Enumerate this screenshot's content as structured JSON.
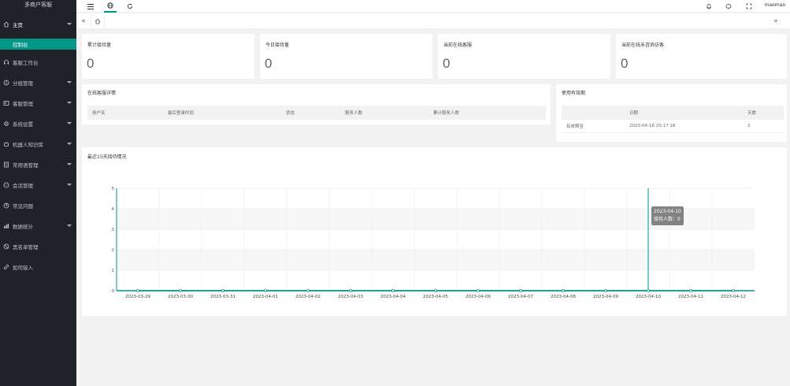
{
  "app": {
    "title": "多商户客服"
  },
  "sidebar": {
    "items": [
      {
        "label": "主页",
        "icon": "home-icon",
        "has_arrow": true,
        "active": true
      },
      {
        "label": "控制台",
        "sub": true,
        "selected": true
      },
      {
        "label": "客服工作台",
        "icon": "headset-icon",
        "has_arrow": false
      },
      {
        "label": "分组管理",
        "icon": "group-icon",
        "has_arrow": true
      },
      {
        "label": "客服管理",
        "icon": "user-card-icon",
        "has_arrow": true
      },
      {
        "label": "系统设置",
        "icon": "gear-icon",
        "has_arrow": true
      },
      {
        "label": "机器人知识库",
        "icon": "robot-icon",
        "has_arrow": true
      },
      {
        "label": "常用语管理",
        "icon": "note-icon",
        "has_arrow": true
      },
      {
        "label": "会话管理",
        "icon": "chat-icon",
        "has_arrow": true
      },
      {
        "label": "常见问题",
        "icon": "question-icon",
        "has_arrow": false
      },
      {
        "label": "数据统计",
        "icon": "stats-icon",
        "has_arrow": true
      },
      {
        "label": "黑名单管理",
        "icon": "blacklist-icon",
        "has_arrow": false
      },
      {
        "label": "如何接入",
        "icon": "link-icon",
        "has_arrow": false
      }
    ]
  },
  "header": {
    "username": "maomao",
    "icons": [
      "menu-icon",
      "globe-icon",
      "refresh-icon",
      "bell-icon",
      "theme-icon",
      "fullscreen-icon"
    ]
  },
  "tabs": {
    "home_icon": "home-icon",
    "left_nav": "«",
    "right_nav": "»"
  },
  "stats": [
    {
      "title": "累计接待量",
      "value": "0"
    },
    {
      "title": "今日接待量",
      "value": "0"
    },
    {
      "title": "当前在线客服",
      "value": "0"
    },
    {
      "title": "当前在线未咨询访客",
      "value": "0"
    }
  ],
  "online_service": {
    "title": "在线客服详情",
    "columns": [
      "用户名",
      "最后登录时间",
      "状态",
      "服务人数",
      "累计服务人数"
    ],
    "rows": []
  },
  "validity": {
    "title": "使用有效期",
    "columns": [
      "",
      "日期",
      "天数"
    ],
    "rows": [
      {
        "label": "有效期至",
        "date": "2023-04-16 20:17:18",
        "days": "2"
      }
    ]
  },
  "chart_card": {
    "title": "最近15天接待情况"
  },
  "tooltip": {
    "date": "2023-04-10",
    "text": "接待人数：0"
  },
  "colors": {
    "accent": "#009688",
    "sidebar_bg": "#20222a"
  },
  "chart_data": {
    "type": "line",
    "x": [
      "2023-03-29",
      "2023-03-30",
      "2023-03-31",
      "2023-04-01",
      "2023-04-02",
      "2023-04-03",
      "2023-04-04",
      "2023-04-05",
      "2023-04-06",
      "2023-04-07",
      "2023-04-08",
      "2023-04-09",
      "2023-04-10",
      "2023-04-11",
      "2023-04-12"
    ],
    "series": [
      {
        "name": "接待人数",
        "values": [
          0,
          0,
          0,
          0,
          0,
          0,
          0,
          0,
          0,
          0,
          0,
          0,
          0,
          0,
          0
        ]
      }
    ],
    "ylim": [
      0,
      5
    ],
    "yticks": [
      "0",
      "1",
      "2",
      "3",
      "4",
      "5"
    ],
    "grid": true,
    "highlight_index": 12
  }
}
